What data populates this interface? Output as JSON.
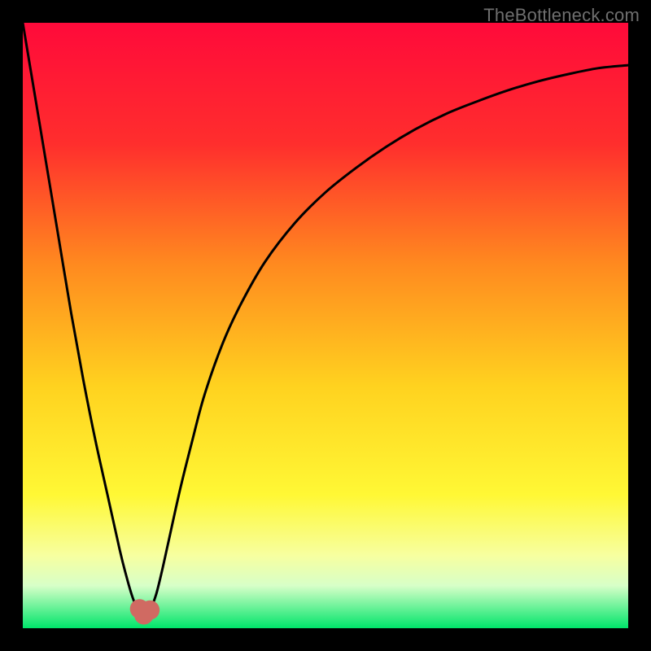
{
  "watermark": "TheBottleneck.com",
  "chart_data": {
    "type": "line",
    "title": "",
    "xlabel": "",
    "ylabel": "",
    "xlim": [
      0,
      100
    ],
    "ylim": [
      0,
      100
    ],
    "grid": false,
    "gradient_stops": [
      {
        "offset": 0.0,
        "color": "#ff0a3a"
      },
      {
        "offset": 0.2,
        "color": "#ff2e2d"
      },
      {
        "offset": 0.4,
        "color": "#ff8a1f"
      },
      {
        "offset": 0.6,
        "color": "#ffd21f"
      },
      {
        "offset": 0.78,
        "color": "#fff835"
      },
      {
        "offset": 0.88,
        "color": "#f7ffa0"
      },
      {
        "offset": 0.93,
        "color": "#d7ffc8"
      },
      {
        "offset": 1.0,
        "color": "#00e56a"
      }
    ],
    "series": [
      {
        "name": "bottleneck-curve",
        "x": [
          0.0,
          2.0,
          4.0,
          6.0,
          8.0,
          10.0,
          12.0,
          14.0,
          16.0,
          17.0,
          18.0,
          19.0,
          20.0,
          21.0,
          22.0,
          23.0,
          24.0,
          26.0,
          28.0,
          30.0,
          33.0,
          36.0,
          40.0,
          45.0,
          50.0,
          55.0,
          60.0,
          65.0,
          70.0,
          75.0,
          80.0,
          85.0,
          90.0,
          95.0,
          100.0
        ],
        "y": [
          100.0,
          88.0,
          76.0,
          64.0,
          52.0,
          41.0,
          31.0,
          22.0,
          13.0,
          9.0,
          5.5,
          3.0,
          2.0,
          3.0,
          5.5,
          9.5,
          14.0,
          23.0,
          31.0,
          38.5,
          47.0,
          53.5,
          60.5,
          67.0,
          72.0,
          76.0,
          79.5,
          82.5,
          85.0,
          87.0,
          88.8,
          90.3,
          91.5,
          92.5,
          93.0
        ]
      }
    ],
    "markers": [
      {
        "name": "min-marker-left",
        "x": 19.3,
        "y": 3.2,
        "r": 1.6,
        "color": "#d06a62"
      },
      {
        "name": "min-marker-mid",
        "x": 20.0,
        "y": 2.2,
        "r": 1.6,
        "color": "#d06a62"
      },
      {
        "name": "min-marker-right",
        "x": 21.0,
        "y": 3.0,
        "r": 1.6,
        "color": "#d06a62"
      }
    ]
  }
}
